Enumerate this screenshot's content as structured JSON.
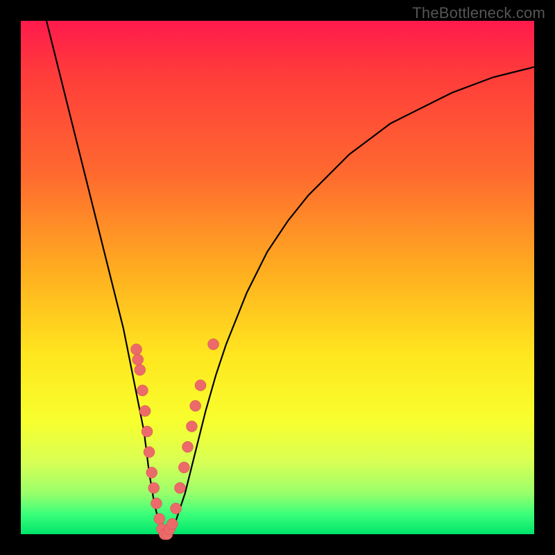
{
  "watermark": "TheBottleneck.com",
  "chart_data": {
    "type": "line",
    "title": "",
    "xlabel": "",
    "ylabel": "",
    "xlim": [
      0,
      100
    ],
    "ylim": [
      0,
      100
    ],
    "series": [
      {
        "name": "bottleneck-curve",
        "x": [
          5,
          8,
          11,
          14,
          17,
          20,
          22,
          24,
          25,
          26,
          27,
          28,
          30,
          32,
          34,
          36,
          38,
          40,
          44,
          48,
          52,
          56,
          60,
          64,
          68,
          72,
          76,
          80,
          84,
          88,
          92,
          96,
          100
        ],
        "values": [
          100,
          88,
          76,
          64,
          52,
          40,
          30,
          20,
          12,
          6,
          2,
          0,
          2,
          8,
          16,
          24,
          31,
          37,
          47,
          55,
          61,
          66,
          70,
          74,
          77,
          80,
          82,
          84,
          86,
          87.5,
          89,
          90,
          91
        ]
      }
    ],
    "markers": [
      {
        "x": 22.5,
        "y": 36
      },
      {
        "x": 22.8,
        "y": 34
      },
      {
        "x": 23.2,
        "y": 32
      },
      {
        "x": 23.7,
        "y": 28
      },
      {
        "x": 24.2,
        "y": 24
      },
      {
        "x": 24.6,
        "y": 20
      },
      {
        "x": 25.0,
        "y": 16
      },
      {
        "x": 25.5,
        "y": 12
      },
      {
        "x": 25.9,
        "y": 9
      },
      {
        "x": 26.4,
        "y": 6
      },
      {
        "x": 27.0,
        "y": 3
      },
      {
        "x": 27.5,
        "y": 1
      },
      {
        "x": 28.0,
        "y": 0
      },
      {
        "x": 28.5,
        "y": 0
      },
      {
        "x": 29.0,
        "y": 1
      },
      {
        "x": 29.5,
        "y": 2
      },
      {
        "x": 30.2,
        "y": 5
      },
      {
        "x": 31.0,
        "y": 9
      },
      {
        "x": 31.8,
        "y": 13
      },
      {
        "x": 32.5,
        "y": 17
      },
      {
        "x": 33.3,
        "y": 21
      },
      {
        "x": 34.0,
        "y": 25
      },
      {
        "x": 35.0,
        "y": 29
      },
      {
        "x": 37.5,
        "y": 37
      }
    ],
    "gradient_stops": [
      {
        "pos": 0,
        "color": "#ff1a4d"
      },
      {
        "pos": 50,
        "color": "#ffe61f"
      },
      {
        "pos": 100,
        "color": "#00e56b"
      }
    ]
  }
}
